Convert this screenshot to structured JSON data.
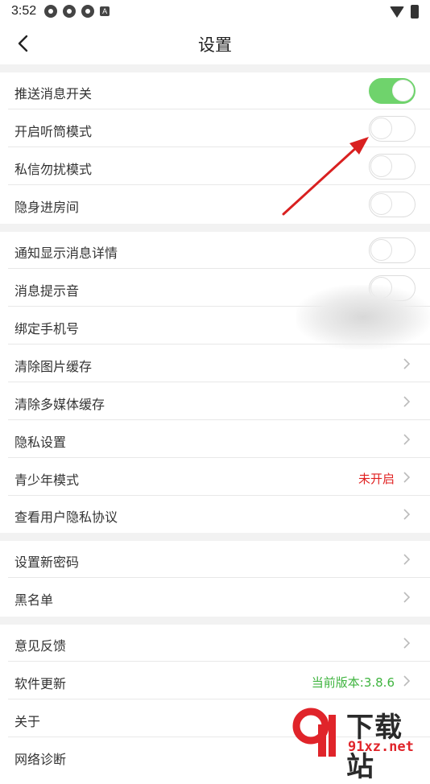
{
  "status_bar": {
    "time": "3:52"
  },
  "header": {
    "title": "设置"
  },
  "settings": {
    "push_toggle": {
      "label": "推送消息开关",
      "on": true
    },
    "earpiece_mode": {
      "label": "开启听筒模式",
      "on": false
    },
    "dnd_mode": {
      "label": "私信勿扰模式",
      "on": false
    },
    "invisible_room": {
      "label": "隐身进房间",
      "on": false
    },
    "notif_detail": {
      "label": "通知显示消息详情",
      "on": false
    },
    "msg_sound": {
      "label": "消息提示音",
      "on": false
    },
    "bind_phone": {
      "label": "绑定手机号"
    },
    "clear_image_cache": {
      "label": "清除图片缓存"
    },
    "clear_media_cache": {
      "label": "清除多媒体缓存"
    },
    "privacy_settings": {
      "label": "隐私设置"
    },
    "teen_mode": {
      "label": "青少年模式",
      "value": "未开启",
      "value_color": "#e02020"
    },
    "privacy_policy": {
      "label": "查看用户隐私协议"
    },
    "new_password": {
      "label": "设置新密码"
    },
    "blacklist": {
      "label": "黑名单"
    },
    "feedback": {
      "label": "意见反馈"
    },
    "software_update": {
      "label": "软件更新",
      "value": "当前版本:3.8.6",
      "value_color": "#3fb43f"
    },
    "about": {
      "label": "关于"
    },
    "network_diagnosis": {
      "label": "网络诊断"
    }
  },
  "watermark": {
    "text": "下载站",
    "url": "91xz.net",
    "logo_text": "9f"
  },
  "colors": {
    "toggle_on": "#6fd36c",
    "accent_red": "#e02020",
    "accent_green": "#3fb43f",
    "section_gap": "#f2f2f2"
  }
}
